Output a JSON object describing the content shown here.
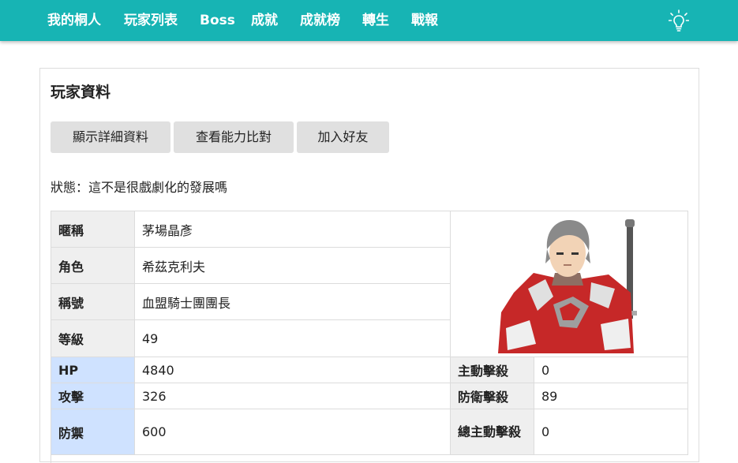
{
  "nav": {
    "items": [
      "我的桐人",
      "玩家列表",
      "Boss",
      "成就",
      "成就榜",
      "轉生",
      "戰報"
    ],
    "theme_icon": "lightbulb-icon"
  },
  "panel": {
    "title": "玩家資料",
    "buttons": [
      "顯示詳細資料",
      "查看能力比對",
      "加入好友"
    ],
    "status": "狀態：這不是很戲劇化的發展嗎"
  },
  "profile": {
    "nickname_label": "暱稱",
    "nickname": "茅場晶彥",
    "character_label": "角色",
    "character": "希茲克利夫",
    "title_label": "稱號",
    "title": "血盟騎士團團長",
    "level_label": "等級",
    "level": "49"
  },
  "stats": {
    "hp_label": "HP",
    "hp": "4840",
    "atk_label": "攻擊",
    "atk": "326",
    "def_label": "防禦",
    "def": "600",
    "active_kills_label": "主動擊殺",
    "active_kills": "0",
    "defense_kills_label": "防衛擊殺",
    "defense_kills": "89",
    "total_active_kills_label": "總主動擊殺",
    "total_active_kills": "0"
  },
  "colors": {
    "nav_bg": "#17b4b4",
    "label_bg": "#efefef",
    "stat_label_bg": "#cfe2ff",
    "button_bg": "#e0e0e0"
  }
}
